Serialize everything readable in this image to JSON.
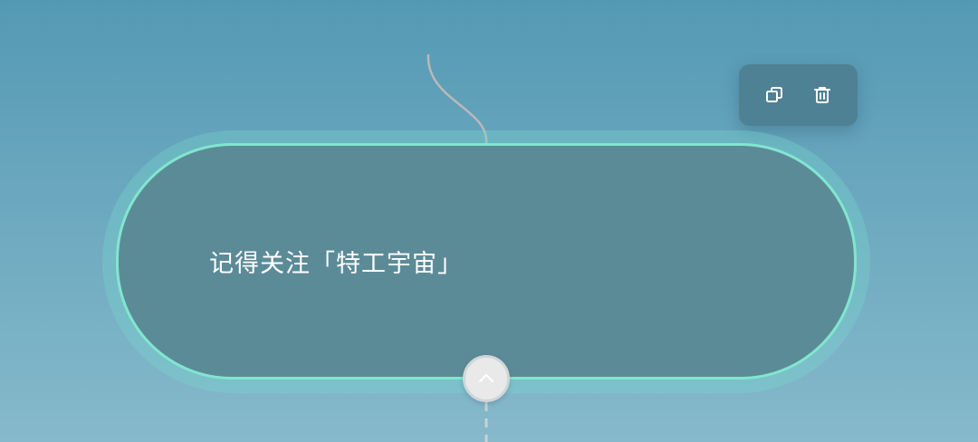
{
  "node": {
    "text": "记得关注「特工宇宙」"
  },
  "toolbar": {
    "copy_icon": "copy-icon",
    "delete_icon": "trash-icon"
  },
  "collapse": {
    "icon": "chevron-up-icon"
  },
  "colors": {
    "node_fill": "#5c8b98",
    "node_border": "#82e6cf",
    "toolbar_bg": "#4e8193",
    "connector": "#b9b9b9"
  }
}
